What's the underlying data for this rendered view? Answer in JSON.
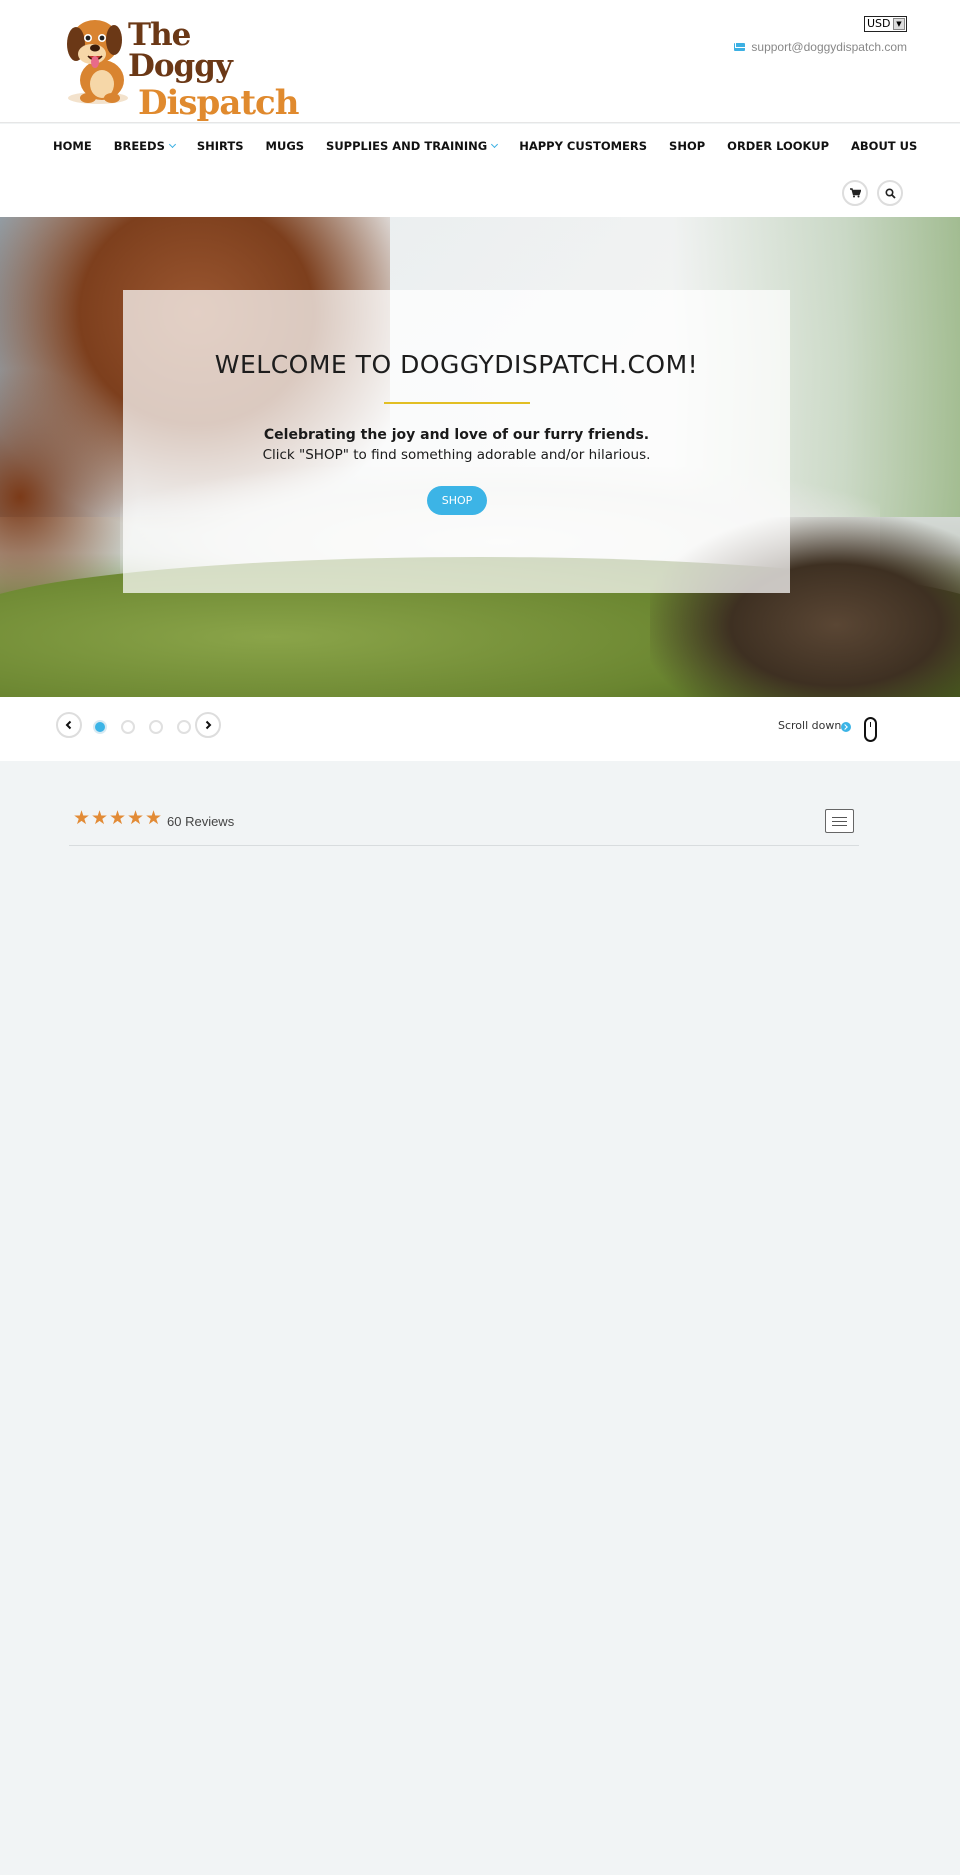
{
  "header": {
    "logo_line1": "The Doggy",
    "logo_line2": "Dispatch",
    "currency": "USD",
    "email": "support@doggydispatch.com"
  },
  "nav": {
    "items": [
      {
        "label": "HOME",
        "has_dropdown": false
      },
      {
        "label": "BREEDS",
        "has_dropdown": true
      },
      {
        "label": "SHIRTS",
        "has_dropdown": false
      },
      {
        "label": "MUGS",
        "has_dropdown": false
      },
      {
        "label": "SUPPLIES AND TRAINING",
        "has_dropdown": true
      },
      {
        "label": "HAPPY CUSTOMERS",
        "has_dropdown": false
      },
      {
        "label": "SHOP",
        "has_dropdown": false
      },
      {
        "label": "ORDER LOOKUP",
        "has_dropdown": false
      },
      {
        "label": "ABOUT US",
        "has_dropdown": false
      }
    ],
    "icons": [
      "cart-icon",
      "search-icon"
    ]
  },
  "hero": {
    "title": "WELCOME TO DOGGYDISPATCH.COM!",
    "subtitle": "Celebrating the joy and love of our furry friends.",
    "text": "Click \"SHOP\" to find something adorable and/or hilarious.",
    "button_label": "SHOP"
  },
  "slider": {
    "slide_count": 4,
    "active_index": 0,
    "scroll_label": "Scroll down"
  },
  "reviews": {
    "rating": 5,
    "count_label": "60 Reviews"
  },
  "colors": {
    "accent": "#3cb4e6",
    "star": "#e28b36",
    "rule": "#e2bf24",
    "page_bg": "#f1f4f5"
  }
}
